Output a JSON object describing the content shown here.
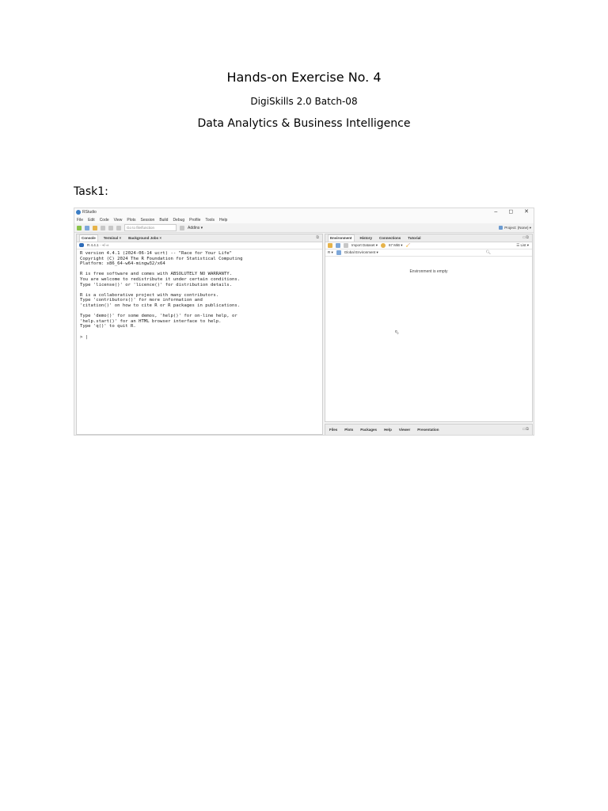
{
  "header": {
    "title": "Hands-on Exercise No. 4",
    "subtitle": "DigiSkills 2.0 Batch-08",
    "course": "Data Analytics & Business Intelligence"
  },
  "task_label": "Task1:",
  "rstudio": {
    "window_title": "RStudio",
    "window_controls": [
      "–",
      "◻",
      "✕"
    ],
    "menu": [
      "File",
      "Edit",
      "Code",
      "View",
      "Plots",
      "Session",
      "Build",
      "Debug",
      "Profile",
      "Tools",
      "Help"
    ],
    "goto_placeholder": "Go to file/function",
    "addins_label": "Addins ▾",
    "project_label": "Project: (None) ▾",
    "left_tabs": [
      "Console",
      "Terminal ×",
      "Background Jobs ×"
    ],
    "r_version_path": "R 4.4.1 · ~/ ⇨",
    "console_lines": [
      "R version 4.4.1 (2024-06-14 ucrt) -- \"Race for Your Life\"",
      "Copyright (C) 2024 The R Foundation for Statistical Computing",
      "Platform: x86_64-w64-mingw32/x64",
      "",
      "R is free software and comes with ABSOLUTELY NO WARRANTY.",
      "You are welcome to redistribute it under certain conditions.",
      "Type 'license()' or 'licence()' for distribution details.",
      "",
      "R is a collaborative project with many contributors.",
      "Type 'contributors()' for more information and",
      "'citation()' on how to cite R or R packages in publications.",
      "",
      "Type 'demo()' for some demos, 'help()' for on-line help, or",
      "'help.start()' for an HTML browser interface to help.",
      "Type 'q()' to quit R.",
      "",
      "> |"
    ],
    "right_tabs": [
      "Environment",
      "History",
      "Connections",
      "Tutorial"
    ],
    "import_dataset": "Import Dataset ▾",
    "memory": "67 MiB ▾",
    "list_mode": "☰ List ▾",
    "r_dropdown": "R ▾",
    "global_env": "Global Environment ▾",
    "env_empty": "Environment is empty",
    "bottom_tabs": [
      "Files",
      "Plots",
      "Packages",
      "Help",
      "Viewer",
      "Presentation"
    ]
  }
}
